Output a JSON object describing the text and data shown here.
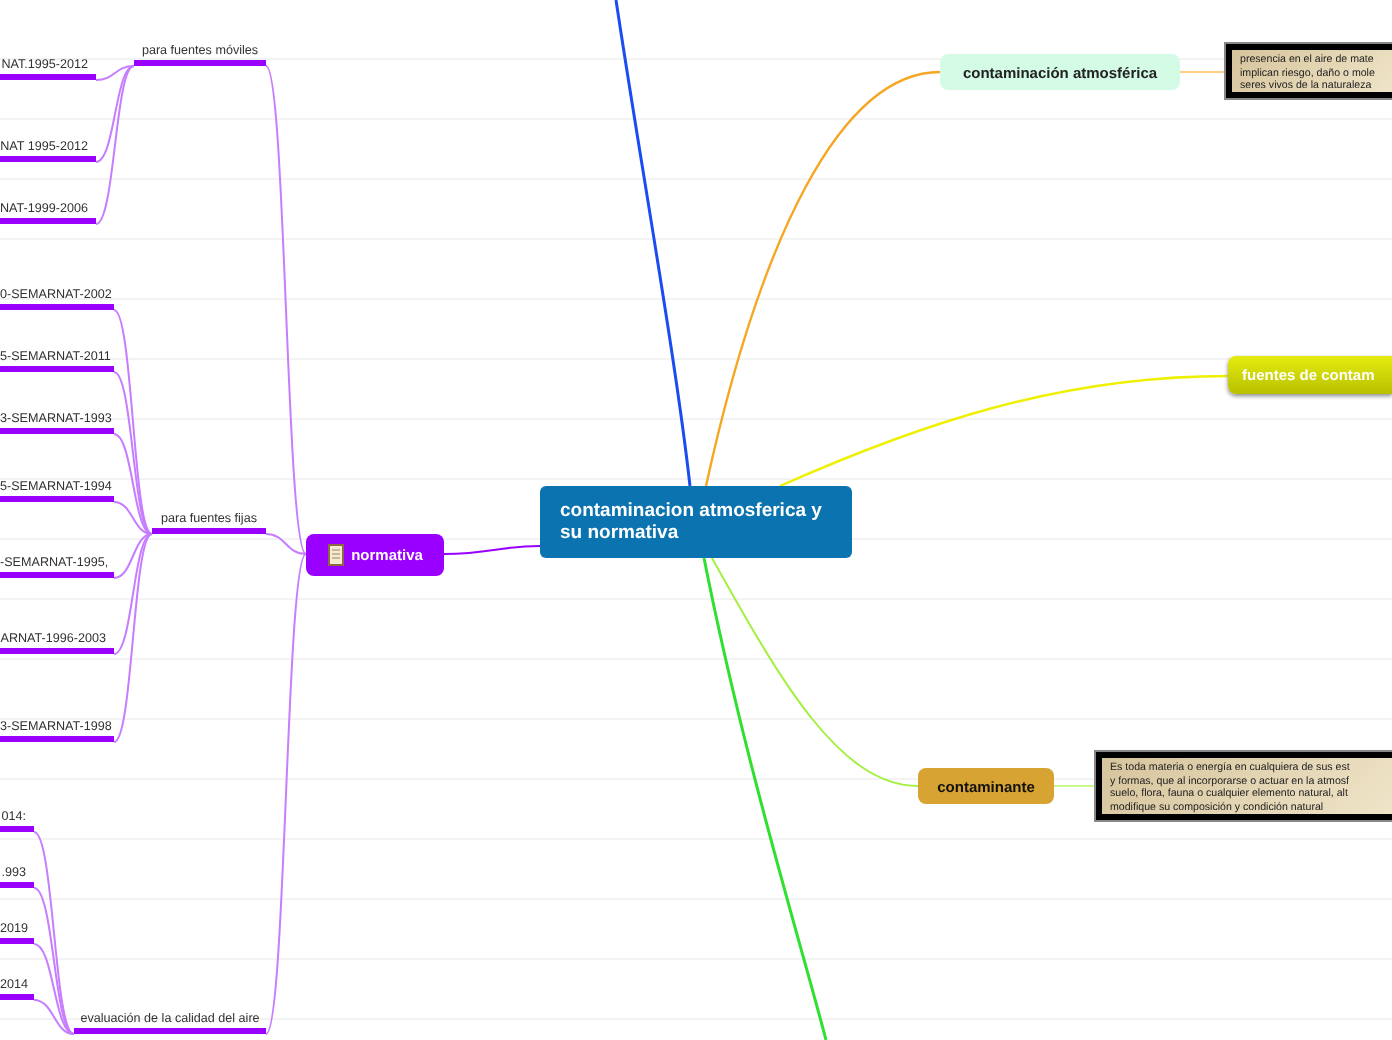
{
  "map": {
    "central_topic": "contaminacion atmosferica y su normativa",
    "branches": [
      {
        "kind": "topic",
        "label": "contaminación atmosférica",
        "children": [
          {
            "kind": "note",
            "lines": [
              "presencia en el aire de mate",
              "implican riesgo, daño o mole",
              "seres vivos de la naturaleza"
            ]
          }
        ]
      },
      {
        "kind": "topic",
        "label": "fuentes de contam"
      },
      {
        "kind": "topic",
        "label": "contaminante",
        "children": [
          {
            "kind": "note",
            "lines": [
              "Es toda materia o energía en cualquiera de sus est",
              "y formas, que al incorporarse o actuar en la atmosf",
              "suelo, flora, fauna o cualquier elemento natural, alt",
              "modifique su composición y condición natural"
            ]
          }
        ]
      },
      {
        "kind": "topic",
        "label": "normativa",
        "children": [
          {
            "kind": "subtopic",
            "label": "para fuentes móviles",
            "children": [
              {
                "kind": "leaf",
                "label": "NAT.1995-2012"
              },
              {
                "kind": "leaf",
                "label": "NAT 1995-2012"
              },
              {
                "kind": "leaf",
                "label": "NAT-1999-2006"
              }
            ]
          },
          {
            "kind": "subtopic",
            "label": "para fuentes fijas",
            "children": [
              {
                "kind": "leaf",
                "label": "0-SEMARNAT-2002"
              },
              {
                "kind": "leaf",
                "label": "5-SEMARNAT-2011"
              },
              {
                "kind": "leaf",
                "label": "3-SEMARNAT-1993"
              },
              {
                "kind": "leaf",
                "label": "5-SEMARNAT-1994"
              },
              {
                "kind": "leaf",
                "label": "-SEMARNAT-1995,"
              },
              {
                "kind": "leaf",
                "label": "ARNAT-1996-2003"
              },
              {
                "kind": "leaf",
                "label": "3-SEMARNAT-1998"
              }
            ]
          },
          {
            "kind": "subtopic",
            "label": "evaluación de la calidad del aire",
            "children": [
              {
                "kind": "leaf",
                "label": "014:"
              },
              {
                "kind": "leaf",
                "label": ".993"
              },
              {
                "kind": "leaf",
                "label": "2019"
              },
              {
                "kind": "leaf",
                "label": "2014"
              }
            ]
          }
        ]
      }
    ]
  }
}
